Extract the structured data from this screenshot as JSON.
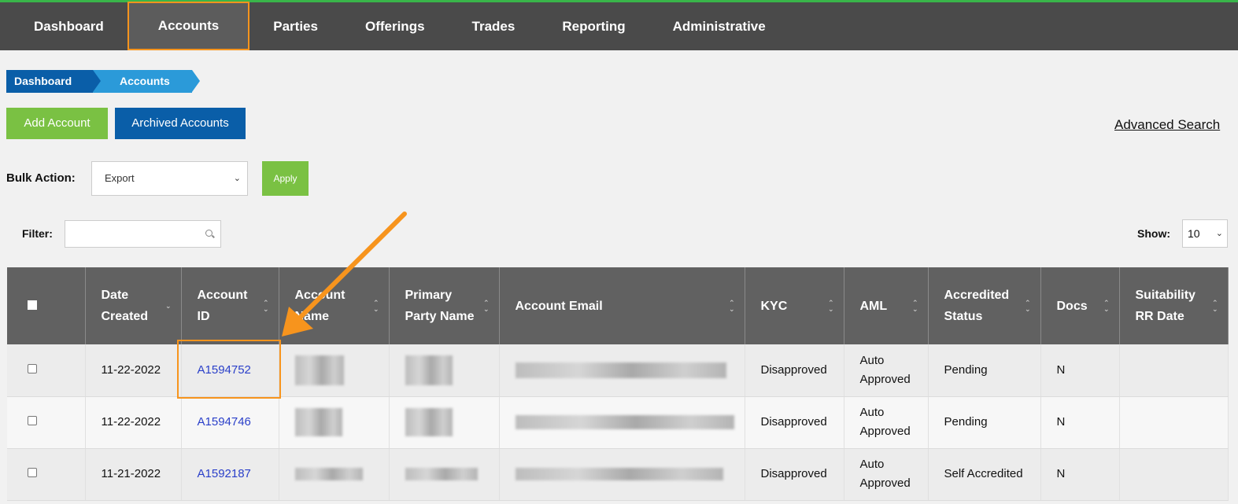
{
  "nav": {
    "items": [
      "Dashboard",
      "Accounts",
      "Parties",
      "Offerings",
      "Trades",
      "Reporting",
      "Administrative"
    ],
    "active": "Accounts"
  },
  "breadcrumb": [
    "Dashboard",
    "Accounts"
  ],
  "toolbar": {
    "add_account": "Add Account",
    "archived_accounts": "Archived Accounts",
    "advanced_search": "Advanced Search"
  },
  "bulk": {
    "label": "Bulk Action:",
    "selected": "Export",
    "apply": "Apply"
  },
  "filter": {
    "label": "Filter:",
    "value": ""
  },
  "show": {
    "label": "Show:",
    "selected": "10"
  },
  "table": {
    "headers": [
      "Date Created",
      "Account ID",
      "Account Name",
      "Primary Party Name",
      "Account Email",
      "KYC",
      "AML",
      "Accredited Status",
      "Docs",
      "Suitability RR Date"
    ],
    "rows": [
      {
        "date": "11-22-2022",
        "id": "A1594752",
        "kyc": "Disapproved",
        "aml": "Auto Approved",
        "accredited": "Pending",
        "docs": "N",
        "rr": ""
      },
      {
        "date": "11-22-2022",
        "id": "A1594746",
        "kyc": "Disapproved",
        "aml": "Auto Approved",
        "accredited": "Pending",
        "docs": "N",
        "rr": ""
      },
      {
        "date": "11-21-2022",
        "id": "A1592187",
        "kyc": "Disapproved",
        "aml": "Auto Approved",
        "accredited": "Self Accredited",
        "docs": "N",
        "rr": ""
      }
    ]
  },
  "colors": {
    "topbar": "#4a4a4a",
    "green": "#7ac143",
    "blue": "#0a5ea8",
    "highlight": "#f7941d"
  }
}
